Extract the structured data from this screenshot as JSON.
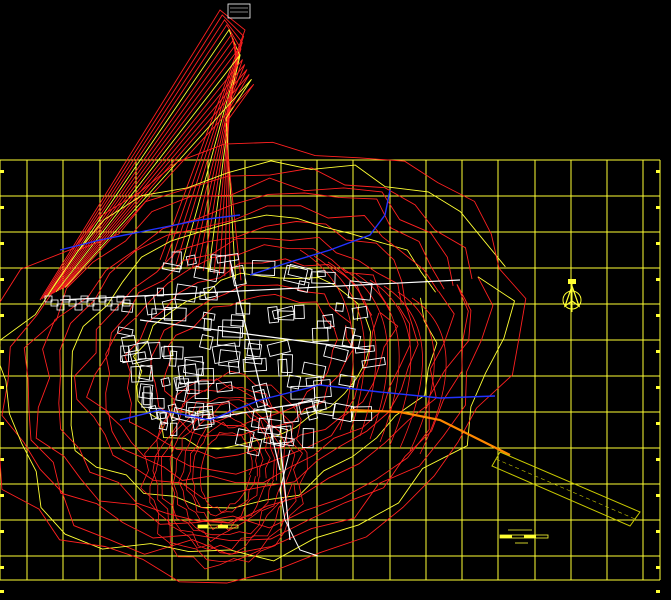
{
  "viewport": {
    "background": "#000000"
  },
  "colors": {
    "grid": "#ffff33",
    "contour": "#ff2020",
    "contour_alt": "#ffff33",
    "streets": "#ffffff",
    "river": "#2233ff",
    "road_major": "#ff8800",
    "runway": "#c8c800"
  },
  "icons": {
    "north_arrow": "north-arrow-icon",
    "scale_bar": "scale-bar-icon"
  }
}
